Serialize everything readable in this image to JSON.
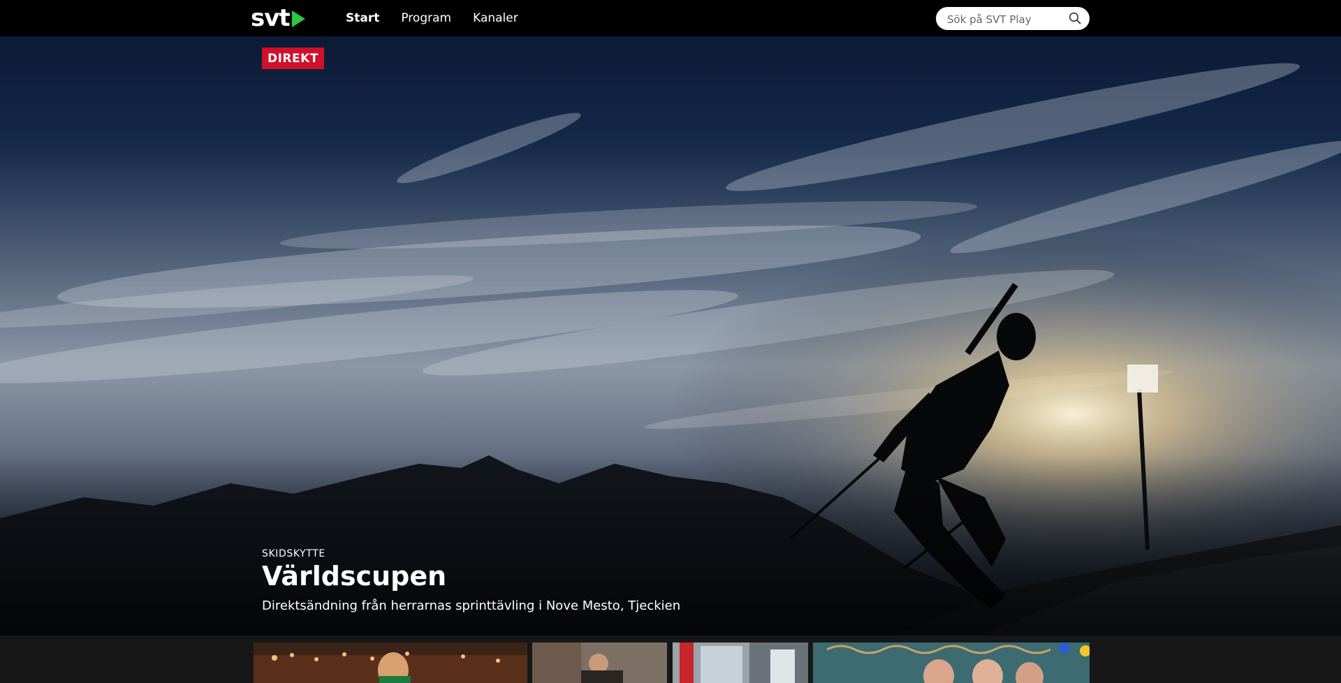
{
  "header": {
    "logo_text": "svt",
    "nav": [
      {
        "label": "Start",
        "active": true
      },
      {
        "label": "Program",
        "active": false
      },
      {
        "label": "Kanaler",
        "active": false
      }
    ],
    "search": {
      "placeholder": "Sök på SVT Play"
    }
  },
  "hero": {
    "badge": "DIREKT",
    "category": "SKIDSKYTTE",
    "title": "Världscupen",
    "description": "Direktsändning från herrarnas sprinttävling i Nove Mesto, Tjeckien"
  },
  "colors": {
    "brand_green": "#2ac941",
    "live_red": "#d0112b",
    "topbar": "#000000"
  },
  "thumbnails": [
    {
      "name": "thumb-1"
    },
    {
      "name": "thumb-2"
    },
    {
      "name": "thumb-3"
    },
    {
      "name": "thumb-4"
    }
  ]
}
